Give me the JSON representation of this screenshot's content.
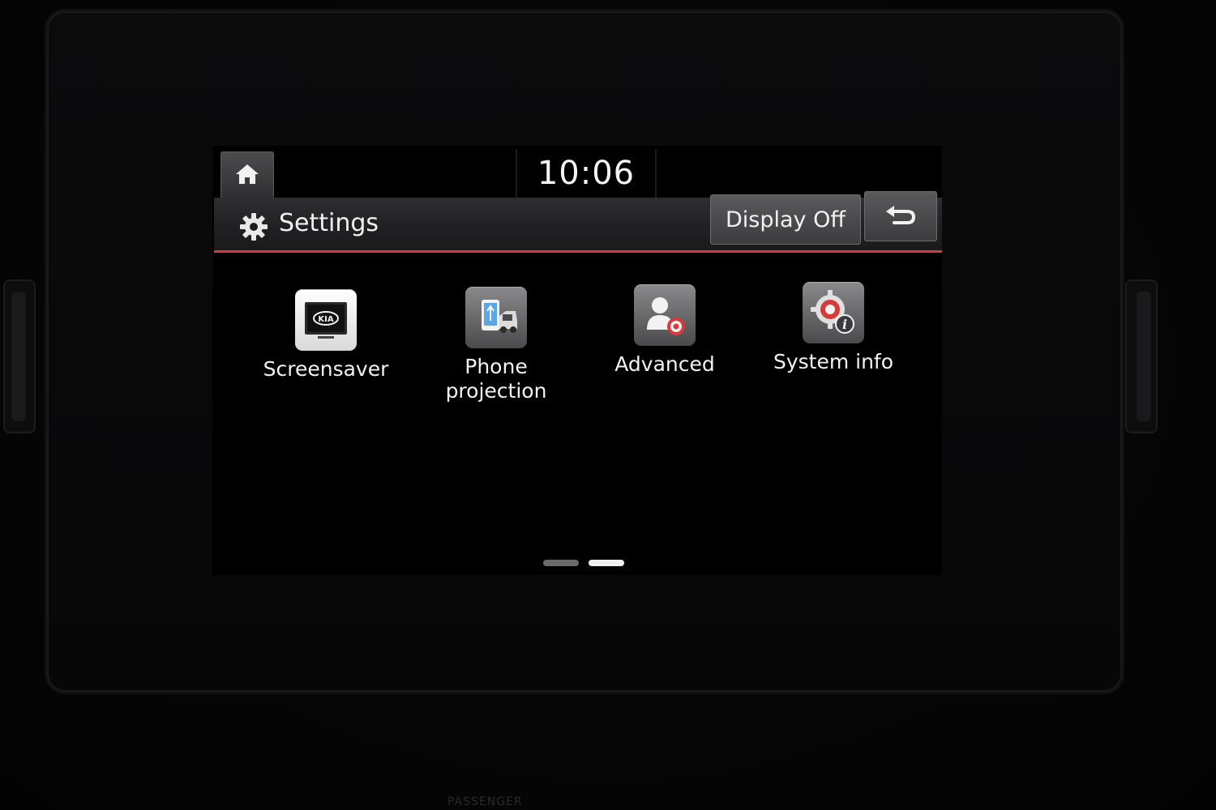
{
  "status": {
    "time": "10:06"
  },
  "header": {
    "title": "Settings",
    "display_off_label": "Display Off"
  },
  "tiles": [
    {
      "label": "Screensaver",
      "icon": "kia-screensaver-icon"
    },
    {
      "label": "Phone\nprojection",
      "icon": "phone-projection-icon"
    },
    {
      "label": "Advanced",
      "icon": "advanced-user-gear-icon"
    },
    {
      "label": "System info",
      "icon": "system-info-icon"
    }
  ],
  "pagination": {
    "current_page": 2,
    "total_pages": 2
  },
  "bezel": {
    "passenger_label": "PASSENGER"
  },
  "colors": {
    "accent": "#d63a3a",
    "text": "#f2f2f2",
    "background": "#000000"
  }
}
